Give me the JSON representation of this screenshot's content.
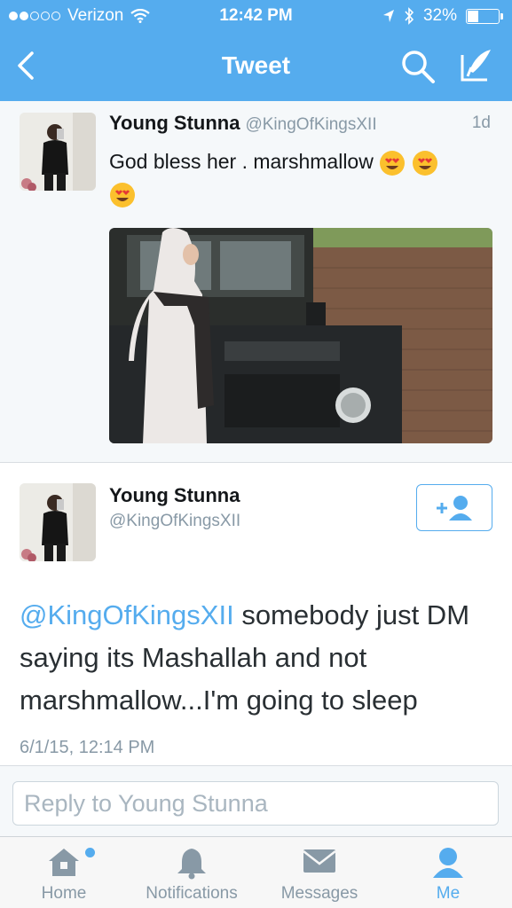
{
  "status_bar": {
    "carrier": "Verizon",
    "time": "12:42 PM",
    "battery": "32%",
    "battery_level": 0.32,
    "signal_bars_filled": 2,
    "signal_bars_total": 5
  },
  "nav": {
    "title": "Tweet"
  },
  "tweet": {
    "name": "Young Stunna",
    "handle": "@KingOfKingsXII",
    "age": "1d",
    "text": "God bless her . marshmallow",
    "emoji": "smiling-face-heart-eyes"
  },
  "reply_tweet": {
    "name": "Young Stunna",
    "handle": "@KingOfKingsXII",
    "mention": "@KingOfKingsXII",
    "text": " somebody just DM saying its Mashallah and not marshmallow...I'm going to sleep",
    "date": "6/1/15, 12:14 PM"
  },
  "reply_box": {
    "placeholder": "Reply to Young Stunna"
  },
  "tabs": {
    "home": "Home",
    "notifications": "Notifications",
    "messages": "Messages",
    "me": "Me"
  },
  "colors": {
    "brand": "#55acee",
    "text": "#292f33",
    "muted": "#8899a6",
    "background": "#f5f8fa"
  }
}
